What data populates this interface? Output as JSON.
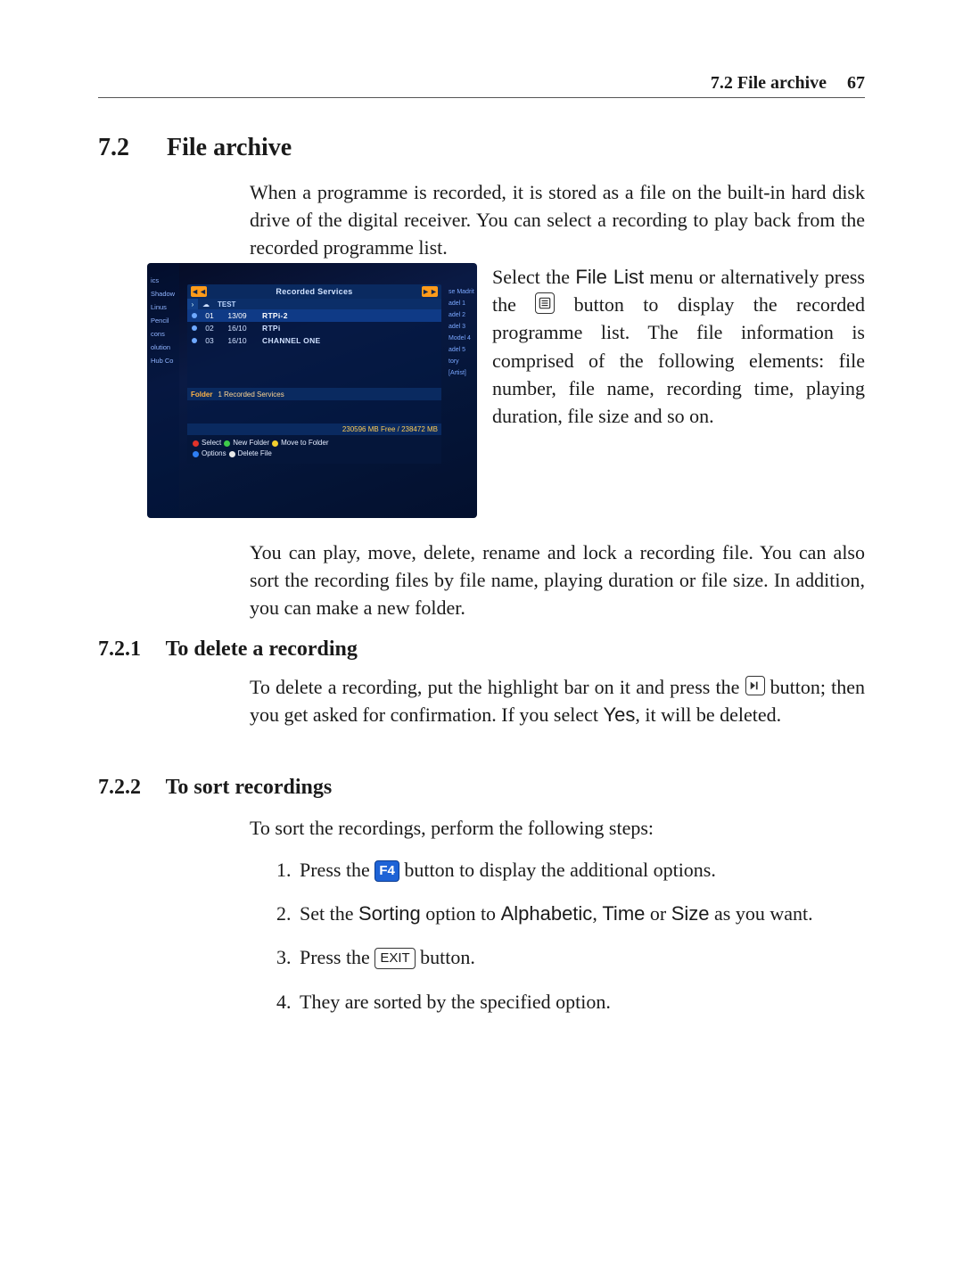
{
  "header": {
    "section_label": "7.2 File archive",
    "page_number": "67"
  },
  "h2": {
    "number": "7.2",
    "title": "File archive"
  },
  "intro": "When a programme is recorded, it is stored as a file on the built-in hard disk drive of the digital receiver. You can select a recording to play back from the recorded programme list.",
  "aside": {
    "pre": "Select the ",
    "filelist": "File List",
    "mid": " menu or alternatively press the ",
    "post": " button to display the recorded programme list. The file information is comprised of the following elements: file number, file name, recording time, playing duration, file size and so on."
  },
  "after": "You can play, move, delete, rename and lock a recording file. You can also sort the recording files by file name, playing duration or file size. In addition, you can make a new folder.",
  "s721": {
    "number": "7.2.1",
    "title": "To delete a recording",
    "pre": "To delete a recording, put the highlight bar on it and press the ",
    "mid": " button; then you get asked for confirmation. If you select ",
    "yes": "Yes",
    "post": ", it will be deleted."
  },
  "s722": {
    "number": "7.2.2",
    "title": "To sort recordings",
    "lead": "To sort the recordings, perform the following steps:",
    "steps": {
      "1a": "Press the ",
      "1b": " button to display the additional options.",
      "2a": "Set the ",
      "2b": "Sorting",
      "2c": " option to ",
      "2d": "Alphabetic",
      "2e": "Time",
      "2f": "Size",
      "2g": " as you want.",
      "3a": "Press the ",
      "3b": " button.",
      "4": "They are sorted by the specified option."
    }
  },
  "keys": {
    "f4": "F4",
    "exit": "EXIT"
  },
  "tv": {
    "title": "Recorded Services",
    "subhead": "TEST",
    "rows": [
      {
        "num": "01",
        "date": "13/09",
        "name": "RTPi-2"
      },
      {
        "num": "02",
        "date": "16/10",
        "name": "RTPi"
      },
      {
        "num": "03",
        "date": "16/10",
        "name": "CHANNEL ONE"
      }
    ],
    "folder_label": "Folder",
    "folder_value": "1 Recorded Services",
    "status": "230596 MB Free / 238472 MB",
    "legend": {
      "select": "Select",
      "newfolder": "New Folder",
      "move": "Move to Folder",
      "options": "Options",
      "delete": "Delete File"
    },
    "left_menu": [
      "ics",
      "Shadow",
      "Linus",
      "Pencil",
      "cons",
      "olution",
      "Hub Co"
    ],
    "right_menu": [
      "se Madrit",
      "adel 1",
      "adel 2",
      "adel 3",
      "Model 4",
      "adel 5",
      "tory",
      "[Artist]"
    ]
  }
}
